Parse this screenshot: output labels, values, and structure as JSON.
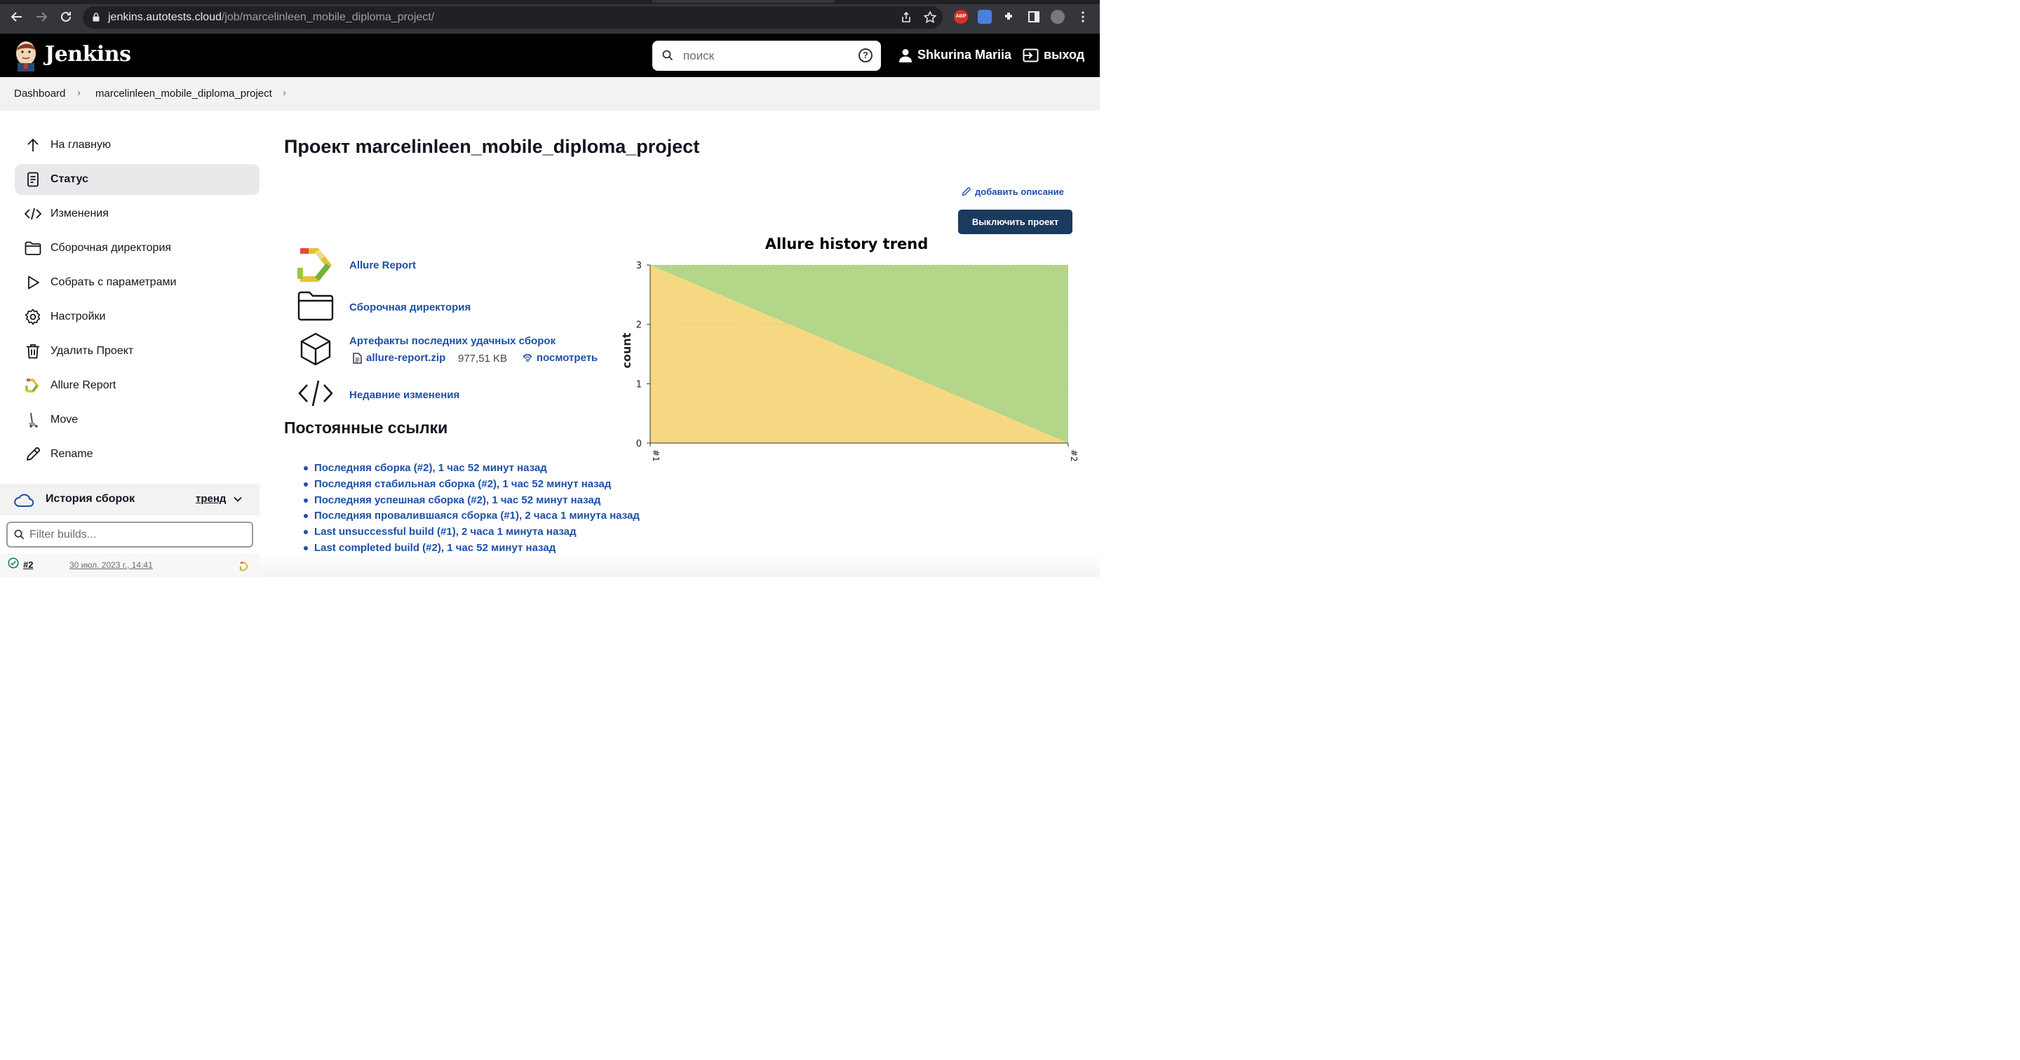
{
  "browser": {
    "url_host": "jenkins.autotests.cloud",
    "url_path": "/job/marcelinleen_mobile_diploma_project/"
  },
  "header": {
    "logo_text": "Jenkins",
    "search_placeholder": "поиск",
    "help_label": "?",
    "user_name": "Shkurina Mariia",
    "logout_label": "выход"
  },
  "breadcrumb": {
    "items": [
      "Dashboard",
      "marcelinleen_mobile_diploma_project"
    ],
    "separator": "›"
  },
  "sidebar": {
    "items": [
      {
        "label": "На главную",
        "icon": "arrow-up-icon"
      },
      {
        "label": "Статус",
        "icon": "document-icon",
        "active": true
      },
      {
        "label": "Изменения",
        "icon": "code-icon"
      },
      {
        "label": "Сборочная директория",
        "icon": "folder-icon"
      },
      {
        "label": "Собрать с параметрами",
        "icon": "play-icon"
      },
      {
        "label": "Настройки",
        "icon": "gear-icon"
      },
      {
        "label": "Удалить Проект",
        "icon": "trash-icon"
      },
      {
        "label": "Allure Report",
        "icon": "allure-icon"
      },
      {
        "label": "Move",
        "icon": "move-icon"
      },
      {
        "label": "Rename",
        "icon": "pencil-icon"
      }
    ],
    "history": {
      "title": "История сборок",
      "trend_label": "тренд",
      "filter_placeholder": "Filter builds...",
      "builds": [
        {
          "number": "#2",
          "date": "30 июл. 2023 г., 14:41",
          "status": "success"
        }
      ]
    }
  },
  "main": {
    "title": "Проект marcelinleen_mobile_diploma_project",
    "add_description": "добавить описание",
    "disable_button": "Выключить проект",
    "links": {
      "allure_report": "Allure Report",
      "workspace": "Сборочная директория",
      "artifacts": "Артефакты последних удачных сборок",
      "recent_changes": "Недавние изменения"
    },
    "artifact": {
      "file": "allure-report.zip",
      "size": "977,51 KB",
      "view": "посмотреть"
    },
    "permalinks_title": "Постоянные ссылки",
    "permalinks": [
      "Последняя сборка (#2), 1 час 52 минут назад",
      "Последняя стабильная сборка (#2), 1 час 52 минут назад",
      "Последняя успешная сборка (#2), 1 час 52 минут назад",
      "Последняя провалившаяся сборка (#1), 2 часа 1 минута назад",
      "Last unsuccessful build (#1), 2 часа 1 минута назад",
      "Last completed build (#2), 1 час 52 минут назад"
    ]
  },
  "colors": {
    "link": "#1e4fa8",
    "header_bg": "#000000",
    "button_bg": "#1a3a5e",
    "chart_passed": "#b3d688",
    "chart_failed": "#f7d882"
  },
  "chart_data": {
    "type": "area",
    "stacked": true,
    "title": "Allure history trend",
    "ylabel": "count",
    "xlabel": "",
    "categories": [
      "#1",
      "#2"
    ],
    "ylim": [
      0,
      3
    ],
    "yticks": [
      0,
      1,
      2,
      3
    ],
    "grid": true,
    "series": [
      {
        "key": "failed",
        "values": [
          3,
          0
        ],
        "color": "#f7d882"
      },
      {
        "key": "passed",
        "values": [
          0,
          3
        ],
        "color": "#b3d688"
      }
    ]
  }
}
